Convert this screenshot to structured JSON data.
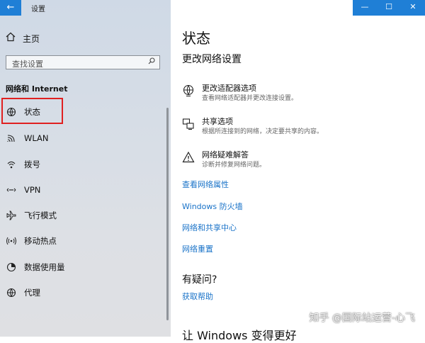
{
  "window": {
    "title": "设置",
    "back_icon": "←",
    "controls": {
      "minimize": "—",
      "maximize": "☐",
      "close": "✕"
    },
    "accent_color": "#1f7fd6"
  },
  "sidebar": {
    "home_label": "主页",
    "search_placeholder": "查找设置",
    "section_title": "网络和 Internet",
    "items": [
      {
        "label": "状态",
        "icon": "status-globe-icon",
        "highlighted": true
      },
      {
        "label": "WLAN",
        "icon": "wifi-icon"
      },
      {
        "label": "拨号",
        "icon": "dialup-icon"
      },
      {
        "label": "VPN",
        "icon": "vpn-icon"
      },
      {
        "label": "飞行模式",
        "icon": "airplane-icon"
      },
      {
        "label": "移动热点",
        "icon": "hotspot-icon"
      },
      {
        "label": "数据使用量",
        "icon": "data-usage-icon"
      },
      {
        "label": "代理",
        "icon": "globe-icon"
      }
    ]
  },
  "main": {
    "title": "状态",
    "subtitle": "更改网络设置",
    "options": [
      {
        "title": "更改适配器选项",
        "desc": "查看网络适配器并更改连接设置。",
        "icon": "adapter-globe-icon"
      },
      {
        "title": "共享选项",
        "desc": "根据所连接到的网络，决定要共享的内容。",
        "icon": "sharing-icon"
      },
      {
        "title": "网络疑难解答",
        "desc": "诊断并修复网络问题。",
        "icon": "warning-icon"
      }
    ],
    "links": [
      "查看网络属性",
      "Windows 防火墙",
      "网络和共享中心",
      "网络重置"
    ],
    "help": {
      "title": "有疑问?",
      "link": "获取帮助"
    },
    "bottom_title": "让 Windows 变得更好"
  },
  "watermark": "知乎 @国际站运营-心飞"
}
